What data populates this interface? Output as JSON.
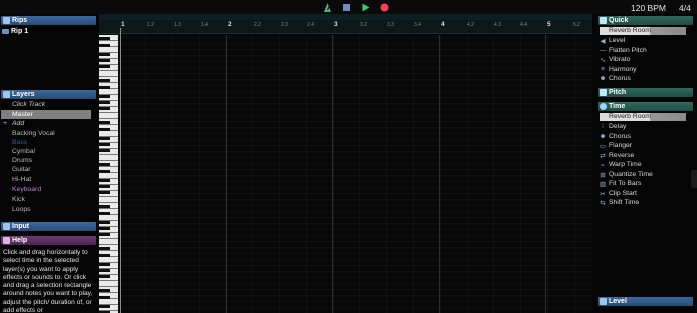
{
  "transport": {
    "bpm": "120 BPM",
    "time_signature": "4/4",
    "colors": {
      "play": "#33cc66",
      "record": "#ff3b5c",
      "stop": "#6b8fbf"
    }
  },
  "left": {
    "rips_title": "Rips",
    "rips": [
      "Rip 1"
    ],
    "layers_title": "Layers",
    "click_track": "Click Track",
    "master": "Master",
    "add": "Add",
    "layers": [
      "Backing Vocal",
      "Bass",
      "Cymbal",
      "Drums",
      "Guitar",
      "Hi-Hat",
      "Keyboard",
      "Kick",
      "Loops"
    ],
    "input_title": "Input",
    "help_title": "Help",
    "help_text": "Click and drag horizontally to select time in the selected layer(s) you want to apply effects or sounds to. Or click and drag a selection rectangle around notes you want to play, adjust the pitch/ duration of, or add effects or"
  },
  "ruler": {
    "bars": [
      "1",
      "2",
      "3",
      "4",
      "5"
    ],
    "beats": [
      "1.2",
      "1.3",
      "1.4",
      "2.2",
      "2.3",
      "2.4",
      "3.2",
      "3.3",
      "3.4",
      "4.2",
      "4.3",
      "4.4",
      "5.2"
    ]
  },
  "right": {
    "quick_title": "Quick",
    "quick_slider": "Reverb Room",
    "quick_items": [
      "Level",
      "Flatten Pitch",
      "Vibrato",
      "Harmony",
      "Chorus"
    ],
    "pitch_title": "Pitch",
    "time_title": "Time",
    "time_slider": "Reverb Room",
    "time_items": [
      "Delay",
      "Chorus",
      "Flanger",
      "Reverse",
      "Warp Time",
      "Quantize Time",
      "Fit To Bars",
      "Clip Start",
      "Shift Time"
    ],
    "level_title": "Level"
  }
}
